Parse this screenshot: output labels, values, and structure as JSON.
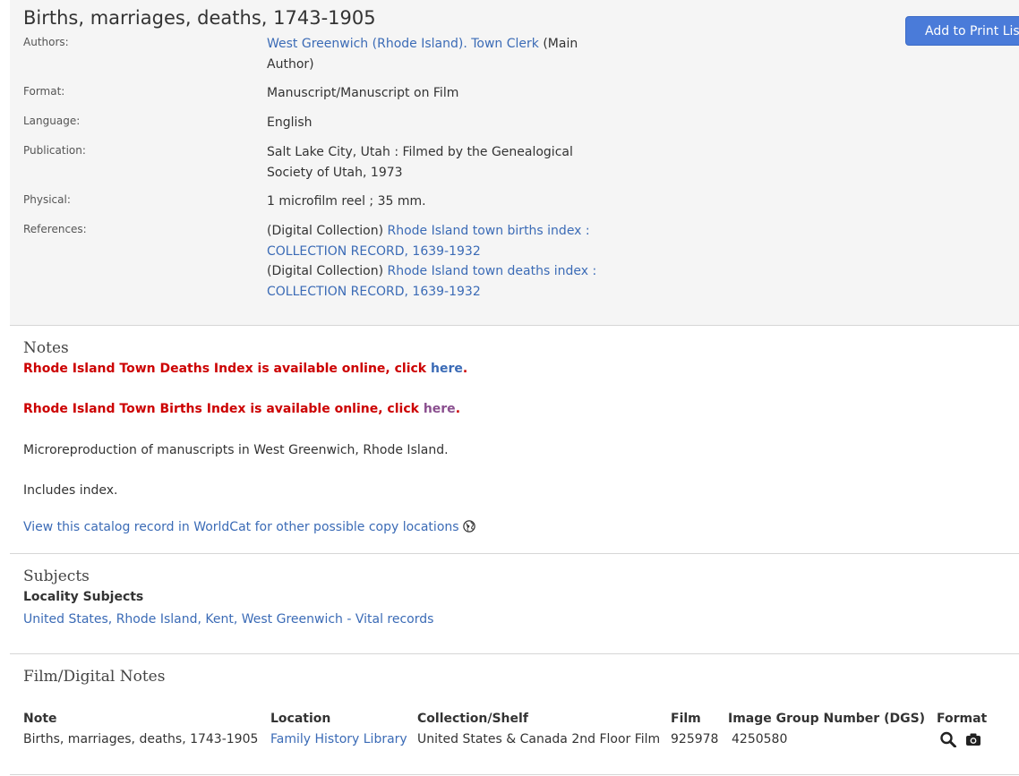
{
  "record": {
    "title": "Births, marriages, deaths, 1743-1905",
    "print_button": "Add to Print List",
    "fields": {
      "authors_label": "Authors:",
      "authors_link": "West Greenwich (Rhode Island). Town Clerk",
      "authors_suffix": " (Main Author)",
      "format_label": "Format:",
      "format_value": "Manuscript/Manuscript on Film",
      "language_label": "Language:",
      "language_value": "English",
      "publication_label": "Publication:",
      "publication_value": "Salt Lake City, Utah : Filmed by the Genealogical Society of Utah, 1973",
      "physical_label": "Physical:",
      "physical_value": "1 microfilm reel ; 35 mm.",
      "references_label": "References:",
      "ref1_prefix": "(Digital Collection) ",
      "ref1_link": "Rhode Island town births index : COLLECTION RECORD, 1639-1932",
      "ref2_prefix": "(Digital Collection) ",
      "ref2_link": "Rhode Island town deaths index : COLLECTION RECORD, 1639-1932"
    }
  },
  "notes": {
    "title": "Notes",
    "deaths_text": "Rhode Island Town Deaths Index is available online, click ",
    "deaths_link": "here",
    "births_text": "Rhode Island Town Births Index is available online, click ",
    "births_link": "here",
    "period": ".",
    "micro": "Microreproduction of manuscripts in West Greenwich, Rhode Island.",
    "index": "Includes index.",
    "worldcat": "View this catalog record in WorldCat for other possible copy locations"
  },
  "subjects": {
    "title": "Subjects",
    "locality_title": "Locality Subjects",
    "locality_link": "United States, Rhode Island, Kent, West Greenwich - Vital records"
  },
  "film": {
    "title": "Film/Digital Notes",
    "headers": {
      "note": "Note",
      "location": "Location",
      "collection": "Collection/Shelf",
      "film": "Film",
      "dgs": "Image Group Number (DGS)",
      "format": "Format"
    },
    "row": {
      "note": "Births, marriages, deaths, 1743-1905",
      "location": "Family History Library",
      "collection": "United States & Canada 2nd Floor Film",
      "film": "925978",
      "dgs": "4250580"
    },
    "icons": [
      "search-icon",
      "camera-icon"
    ]
  }
}
